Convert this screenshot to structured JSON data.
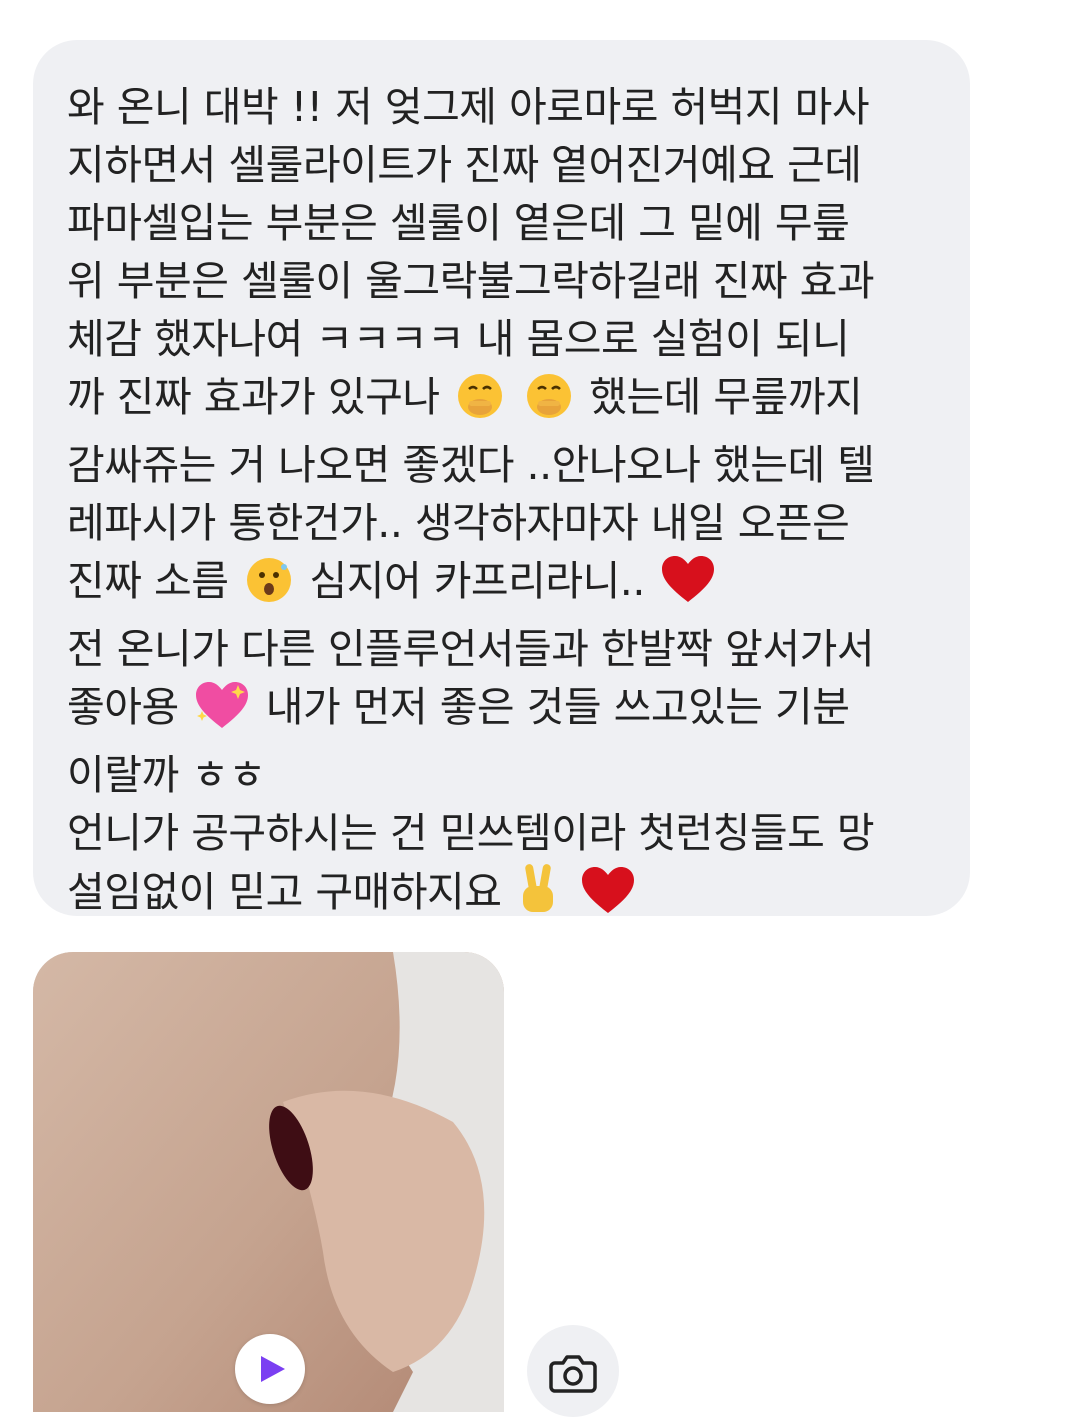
{
  "message": {
    "lines": [
      "와 온니 대박 !! 저 엊그제 아로마로 허벅지 마사",
      "지하면서 셀룰라이트가 진짜 옅어진거예요 근데",
      "파마셀입는 부분은 셀룰이 옅은데 그 밑에 무릎",
      "위 부분은 셀룰이 울그락불그락하길래 진짜 효과",
      "체감 했자나여 ㅋㅋㅋㅋ 내 몸으로 실험이 되니",
      [
        "까 진짜 효과가 있구나 ",
        "했는데 무릎까지"
      ],
      "감싸쥬는 거 나오면 좋겠다 ..안나오나 했는데 텔",
      "레파시가 통한건가.. 생각하자마자 내일 오픈은",
      [
        "진짜 소름 ",
        " 심지어 카프리라니.. "
      ],
      "전 온니가 다른 인플루언서들과 한발짝 앞서가서",
      [
        "좋아용 ",
        " 내가 먼저 좋은 것들 쓰고있는 기분"
      ],
      "이랄까 ㅎㅎ",
      "언니가 공구하시는 건 믿쓰템이라 첫런칭들도 망",
      [
        "설임없이 믿고 구매하지요 ",
        " "
      ]
    ],
    "emojis": {
      "line6": [
        "hand-over-mouth-emoji",
        "hand-over-mouth-emoji"
      ],
      "line9": [
        "astonished-face-emoji",
        "red-heart-emoji"
      ],
      "line11": [
        "sparkling-heart-emoji"
      ],
      "line14": [
        "victory-hand-emoji",
        "red-heart-emoji"
      ]
    }
  },
  "attachments": {
    "photo": "photo-attachment",
    "play": "play-icon",
    "camera": "camera-icon"
  },
  "colors": {
    "bubble_bg": "#eff0f3",
    "text": "#222222",
    "play_accent": "#7b3ff2",
    "heart": "#d7101c"
  }
}
